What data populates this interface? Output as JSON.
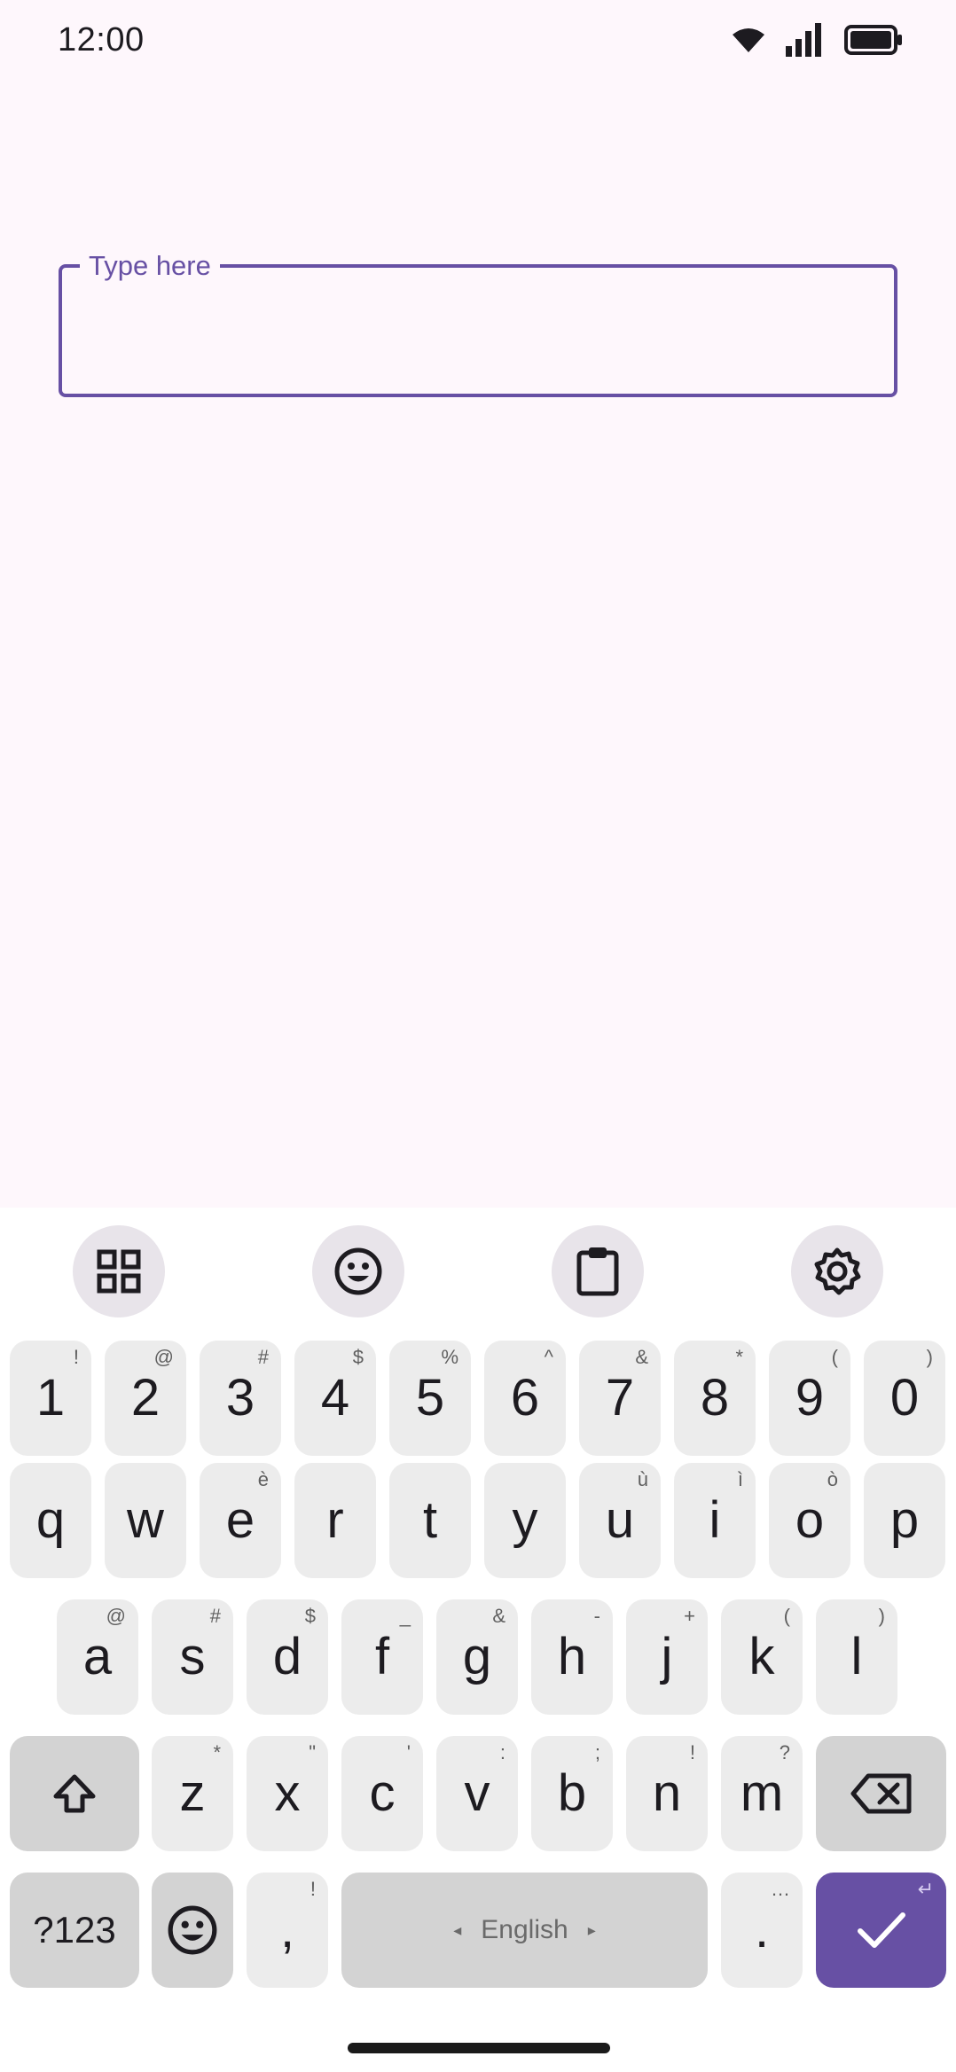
{
  "status_bar": {
    "time": "12:00",
    "icons": [
      "wifi-icon",
      "cellular-signal-icon",
      "battery-icon"
    ]
  },
  "text_field": {
    "label": "Type here",
    "value": ""
  },
  "keyboard": {
    "toolbar": [
      "apps-grid-icon",
      "emoji-icon",
      "clipboard-icon",
      "settings-gear-icon"
    ],
    "number_row": [
      {
        "main": "1",
        "hint": "!"
      },
      {
        "main": "2",
        "hint": "@"
      },
      {
        "main": "3",
        "hint": "#"
      },
      {
        "main": "4",
        "hint": "$"
      },
      {
        "main": "5",
        "hint": "%"
      },
      {
        "main": "6",
        "hint": "^"
      },
      {
        "main": "7",
        "hint": "&"
      },
      {
        "main": "8",
        "hint": "*"
      },
      {
        "main": "9",
        "hint": "("
      },
      {
        "main": "0",
        "hint": ")"
      }
    ],
    "row1": [
      {
        "main": "q",
        "hint": ""
      },
      {
        "main": "w",
        "hint": ""
      },
      {
        "main": "e",
        "hint": "è"
      },
      {
        "main": "r",
        "hint": ""
      },
      {
        "main": "t",
        "hint": ""
      },
      {
        "main": "y",
        "hint": ""
      },
      {
        "main": "u",
        "hint": "ù"
      },
      {
        "main": "i",
        "hint": "ì"
      },
      {
        "main": "o",
        "hint": "ò"
      },
      {
        "main": "p",
        "hint": ""
      }
    ],
    "row2": [
      {
        "main": "a",
        "hint": "@"
      },
      {
        "main": "s",
        "hint": "#"
      },
      {
        "main": "d",
        "hint": "$"
      },
      {
        "main": "f",
        "hint": "_"
      },
      {
        "main": "g",
        "hint": "&"
      },
      {
        "main": "h",
        "hint": "-"
      },
      {
        "main": "j",
        "hint": "+"
      },
      {
        "main": "k",
        "hint": "("
      },
      {
        "main": "l",
        "hint": ")"
      }
    ],
    "row3": [
      {
        "main": "z",
        "hint": "*"
      },
      {
        "main": "x",
        "hint": "\""
      },
      {
        "main": "c",
        "hint": "'"
      },
      {
        "main": "v",
        "hint": ":"
      },
      {
        "main": "b",
        "hint": ";"
      },
      {
        "main": "n",
        "hint": "!"
      },
      {
        "main": "m",
        "hint": "?"
      }
    ],
    "bottom": {
      "symbols_label": "?123",
      "comma": {
        "main": ",",
        "hint": "!"
      },
      "space_label": "English",
      "space_left_arrow": "◂",
      "space_right_arrow": "▸",
      "period": {
        "main": ".",
        "hint": "…"
      },
      "enter_hint": "↵"
    },
    "colors": {
      "accent": "#6750a4",
      "key": "#ececec",
      "func_key": "#d3d3d3"
    }
  }
}
